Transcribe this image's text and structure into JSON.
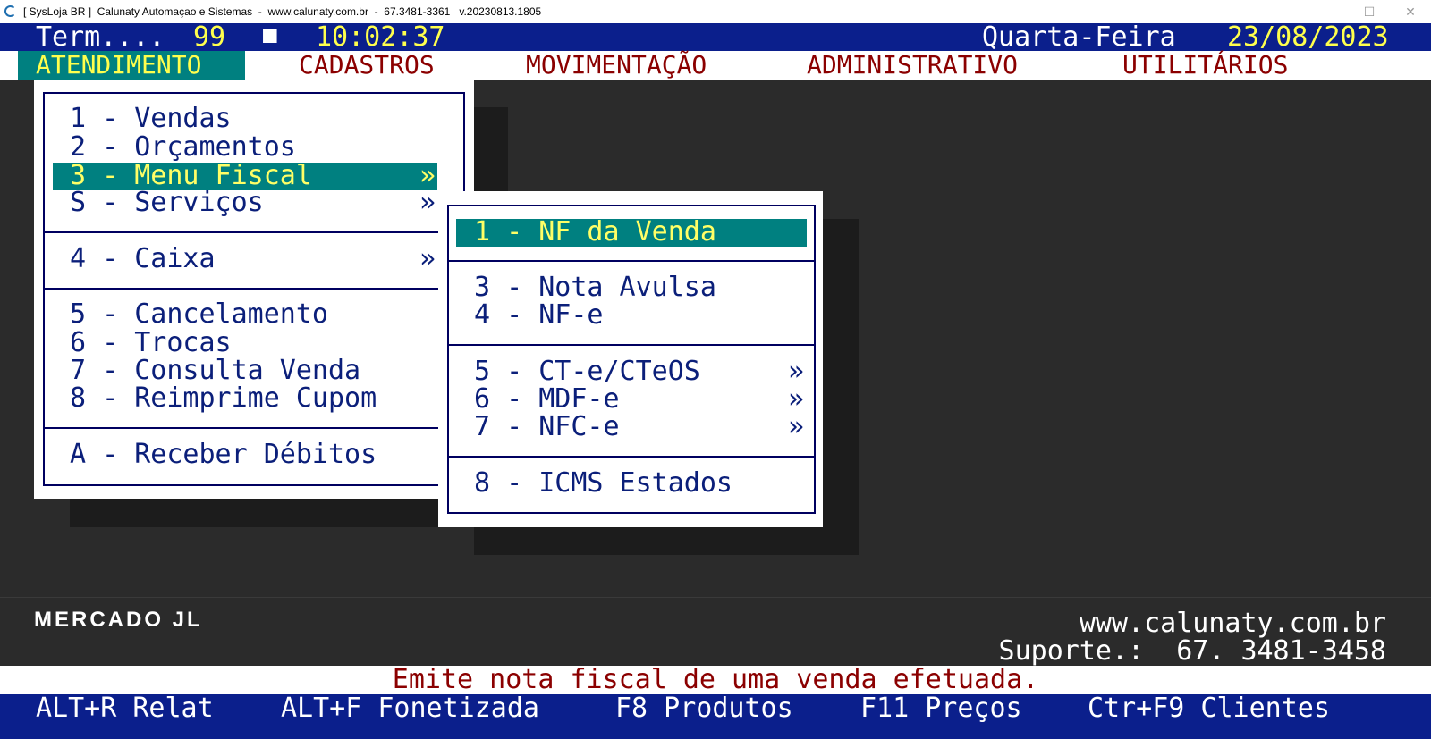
{
  "window": {
    "title": "[ SysLoja BR ]  Calunaty Automaçao e Sistemas  -  www.calunaty.com.br  -  67.3481-3361   v.20230813.1805",
    "minimize": "—",
    "maximize": "☐",
    "close": "✕"
  },
  "status": {
    "term_label": "Term....",
    "term_number": "99",
    "indicator": "■",
    "time": "10:02:37",
    "weekday": "Quarta-Feira",
    "date": "23/08/2023"
  },
  "menubar": {
    "items": [
      "ATENDIMENTO",
      "CADASTROS",
      "MOVIMENTAÇÃO",
      "ADMINISTRATIVO",
      "UTILITÁRIOS"
    ]
  },
  "atendimento_menu": {
    "items": [
      "1 - Vendas",
      "2 - Orçamentos",
      "3 - Menu Fiscal",
      "S - Serviços",
      "4 - Caixa",
      "5 - Cancelamento",
      "6 - Trocas",
      "7 - Consulta Venda",
      "8 - Reimprime Cupom",
      "A - Receber Débitos"
    ],
    "submenu_arrow": "»"
  },
  "fiscal_menu": {
    "items": [
      "1 - NF da Venda",
      "3 - Nota Avulsa",
      "4 - NF-e",
      "5 - CT-e/CTeOS",
      "6 - MDF-e",
      "7 - NFC-e",
      "8 - ICMS Estados"
    ],
    "submenu_arrow": "»"
  },
  "footer": {
    "brand": "MERCADO JL",
    "website": "www.calunaty.com.br",
    "support": "Suporte.:  67. 3481-3458",
    "hint": "Emite nota fiscal de uma venda efetuada."
  },
  "shortcuts": [
    "ALT+R Relat",
    "ALT+F Fonetizada",
    "F8 Produtos",
    "F11 Preços",
    "Ctr+F9 Clientes"
  ],
  "colors": {
    "status_bg": "#0b1f8c",
    "highlight_bg": "#008080",
    "highlight_fg": "#ffff66",
    "menu_text": "#8b0000",
    "item_text": "#0b1f7a"
  }
}
